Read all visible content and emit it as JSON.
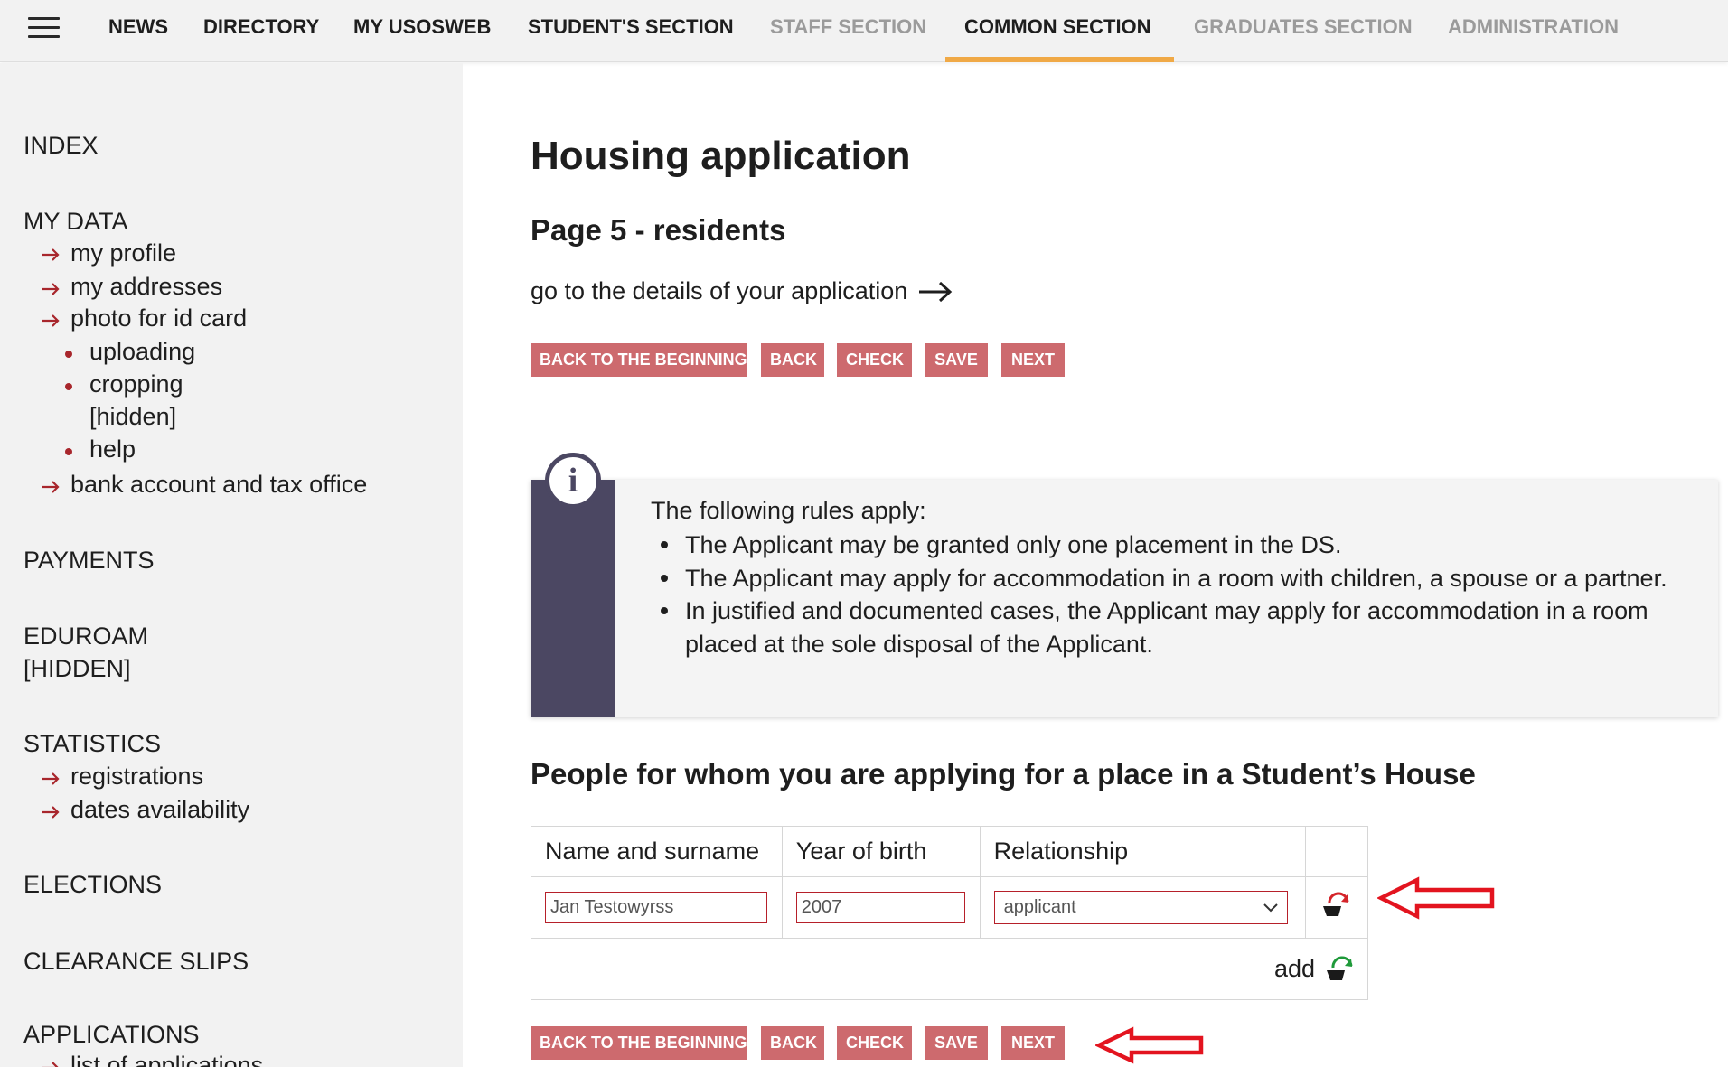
{
  "nav": {
    "tabs": [
      {
        "label": "NEWS"
      },
      {
        "label": "DIRECTORY"
      },
      {
        "label": "MY USOSWEB"
      },
      {
        "label": "STUDENT'S SECTION"
      },
      {
        "label": "STAFF SECTION"
      },
      {
        "label": "COMMON SECTION"
      },
      {
        "label": "GRADUATES SECTION"
      },
      {
        "label": "ADMINISTRATION"
      }
    ],
    "active_tab": "COMMON SECTION",
    "accent_color": "#f0a946"
  },
  "sidebar": {
    "index": "INDEX",
    "my_data": {
      "label": "MY DATA",
      "my_profile": "my profile",
      "my_addresses": "my addresses",
      "photo": "photo for id card",
      "uploading": "uploading",
      "cropping": "cropping",
      "hidden": "[hidden]",
      "help": "help",
      "bank": "bank account and tax office"
    },
    "payments": "PAYMENTS",
    "eduroam": "EDUROAM",
    "eduroam_hidden": "[HIDDEN]",
    "statistics": {
      "label": "STATISTICS",
      "registrations": "registrations",
      "dates": "dates availability"
    },
    "elections": "ELECTIONS",
    "clearance": "CLEARANCE SLIPS",
    "applications": {
      "label": "APPLICATIONS",
      "list": "list of applications"
    }
  },
  "main": {
    "title": "Housing application",
    "subtitle": "Page 5 - residents",
    "details_link": "go to the details of your application",
    "buttons": {
      "beginning": "BACK TO THE BEGINNING",
      "back": "BACK",
      "check": "CHECK",
      "save": "SAVE",
      "next": "NEXT"
    },
    "button_color": "#cd6a6e",
    "info": {
      "intro": "The following rules apply:",
      "rules": [
        "The Applicant may be granted only one placement in the DS.",
        "The Applicant may apply for accommodation in a room with children, a spouse or a partner.",
        "In justified and documented cases, the Applicant may apply for accommodation in a room placed at the sole disposal of the Applicant."
      ],
      "icon": "info-icon",
      "bar_color": "#4b4762"
    },
    "section_heading": "People for whom you are applying for a place in a Student’s House",
    "table": {
      "headers": [
        "Name and surname",
        "Year of birth",
        "Relationship"
      ],
      "row": {
        "name": "Jan Testowyrss",
        "year": "2007",
        "relationship": "applicant"
      },
      "add_label": "add"
    }
  }
}
